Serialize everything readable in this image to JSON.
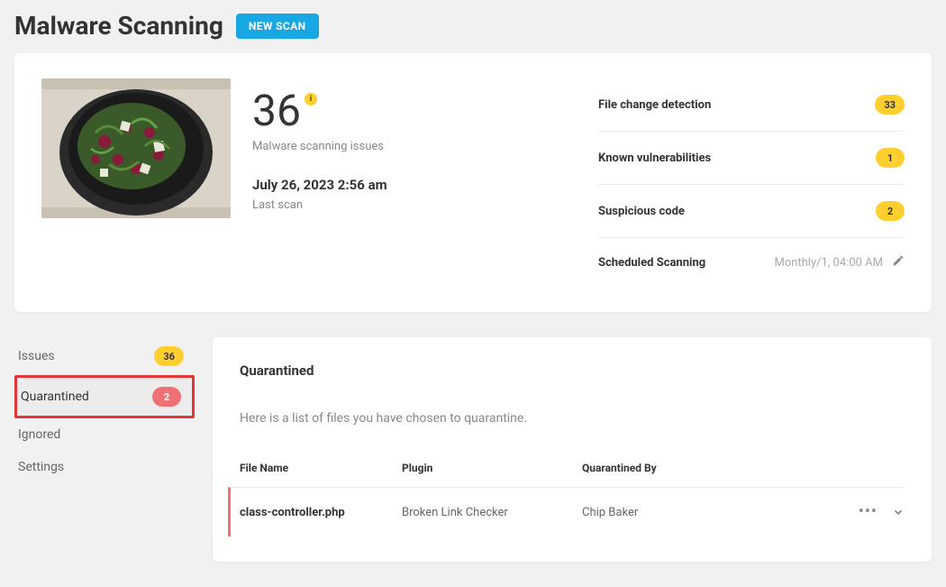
{
  "header": {
    "title": "Malware Scanning",
    "new_scan_label": "NEW SCAN"
  },
  "summary": {
    "issue_count": "36",
    "issues_label": "Malware scanning issues",
    "last_scan_date": "July 26, 2023 2:56 am",
    "last_scan_label": "Last scan",
    "stats": [
      {
        "label": "File change detection",
        "count": "33"
      },
      {
        "label": "Known vulnerabilities",
        "count": "1"
      },
      {
        "label": "Suspicious code",
        "count": "2"
      }
    ],
    "schedule_label": "Scheduled Scanning",
    "schedule_value": "Monthly/1, 04:00 AM"
  },
  "sidebar": {
    "items": [
      {
        "label": "Issues",
        "count": "36",
        "pill": "yellow"
      },
      {
        "label": "Quarantined",
        "count": "2",
        "pill": "red",
        "active": true
      },
      {
        "label": "Ignored"
      },
      {
        "label": "Settings"
      }
    ]
  },
  "panel": {
    "title": "Quarantined",
    "description": "Here is a list of files you have chosen to quarantine.",
    "columns": {
      "filename": "File Name",
      "plugin": "Plugin",
      "by": "Quarantined By"
    },
    "rows": [
      {
        "filename": "class-controller.php",
        "plugin": "Broken Link Checker",
        "by": "Chip Baker"
      }
    ]
  }
}
